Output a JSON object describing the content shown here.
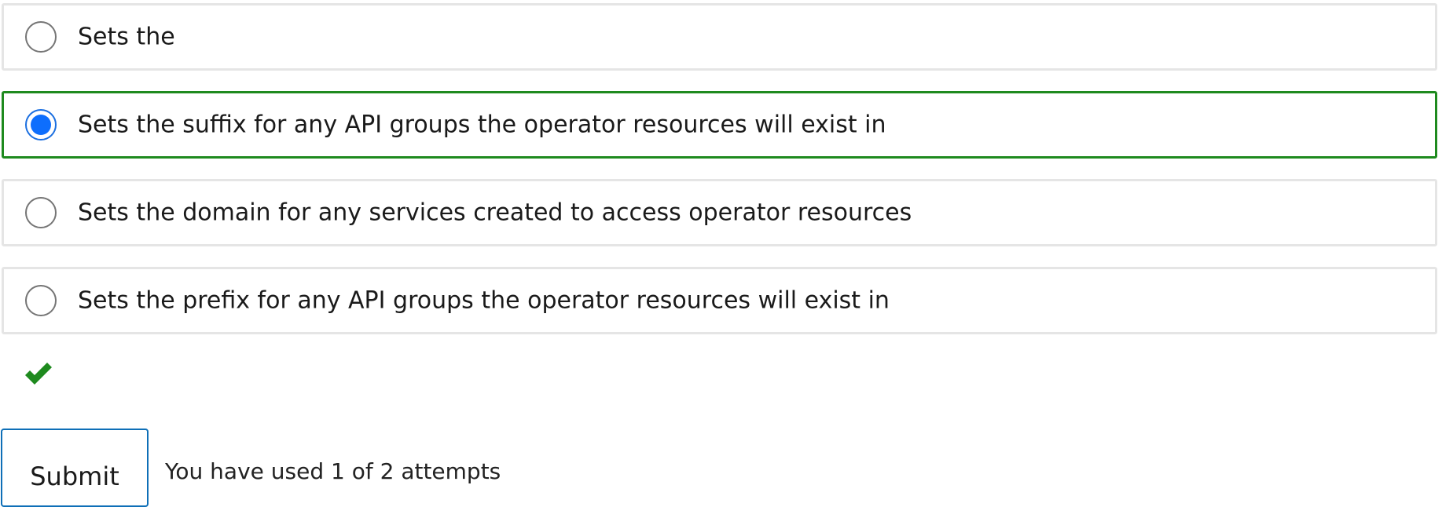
{
  "question": {
    "options": [
      {
        "label": "Sets the",
        "selected": false
      },
      {
        "label": "Sets the suffix for any API groups the operator resources will exist in",
        "selected": true
      },
      {
        "label": "Sets the domain for any services created to access operator resources",
        "selected": false
      },
      {
        "label": "Sets the prefix for any API groups the operator resources will exist in",
        "selected": false
      }
    ],
    "status_icon": "checkmark-icon",
    "status_color": "#1e8a1e",
    "selected_border_color": "#1e8a1e",
    "radio_selected_color": "#0d6efd"
  },
  "actions": {
    "submit_label": "Submit",
    "attempts_text": "You have used 1 of 2 attempts"
  }
}
